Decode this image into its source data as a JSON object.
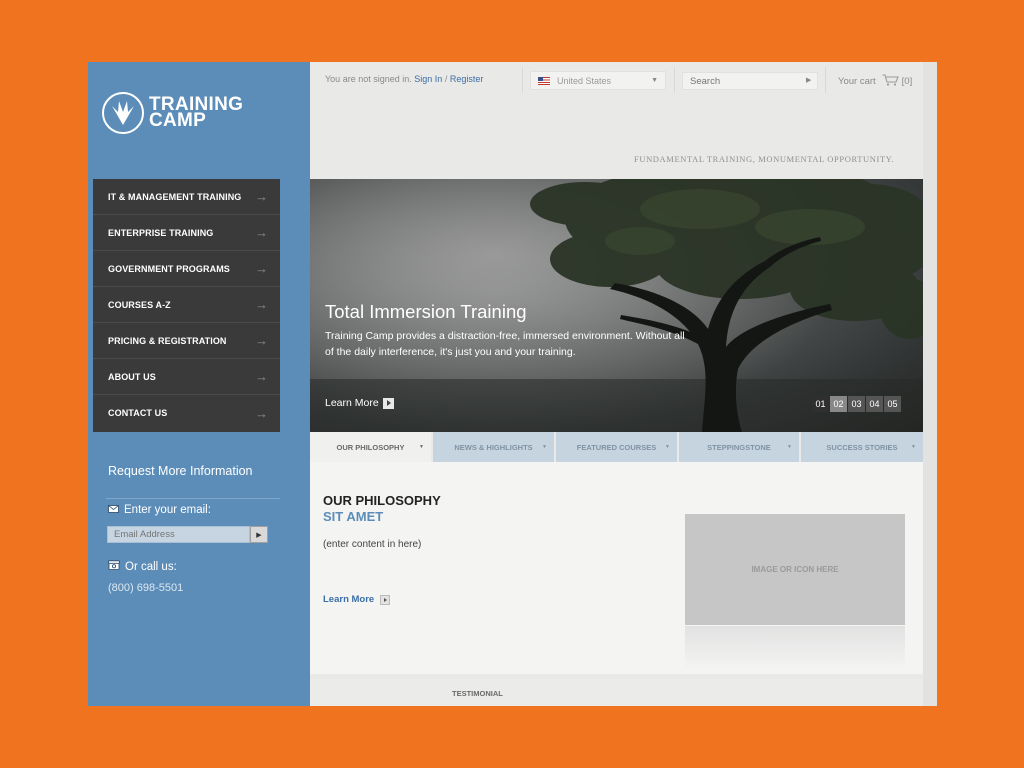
{
  "brand": {
    "line1": "TRAINING",
    "line2": "CAMP"
  },
  "topbar": {
    "signin_prefix": "You are not signed in.",
    "signin_link": "Sign In",
    "separator": "/",
    "register_link": "Register",
    "country": "United States",
    "search_placeholder": "Search",
    "cart_label": "Your cart",
    "cart_count": "[0]"
  },
  "tagline": "FUNDAMENTAL TRAINING, MONUMENTAL OPPORTUNITY.",
  "nav": {
    "items": [
      "IT & MANAGEMENT TRAINING",
      "ENTERPRISE TRAINING",
      "GOVERNMENT PROGRAMS",
      "COURSES A-Z",
      "PRICING & REGISTRATION",
      "ABOUT US",
      "CONTACT US"
    ]
  },
  "hero": {
    "title": "Total Immersion Training",
    "text": "Training Camp provides a distraction-free, immersed environment. Without all of the daily interference, it's just you and your training.",
    "learn_more": "Learn More",
    "pager": [
      "01",
      "02",
      "03",
      "04",
      "05"
    ]
  },
  "sidebar": {
    "request_title": "Request More Information",
    "email_label": "Enter your email:",
    "email_placeholder": "Email Address",
    "call_label": "Or call us:",
    "phone": "(800) 698-5501"
  },
  "tabs": [
    "OUR PHILOSOPHY",
    "NEWS & HIGHLIGHTS",
    "FEATURED COURSES",
    "STEPPINGSTONE",
    "SUCCESS STORIES"
  ],
  "content": {
    "title": "OUR PHILOSOPHY",
    "subtitle": "SIT AMET",
    "body": "(enter content in here)",
    "learn_more": "Learn More",
    "image_placeholder": "IMAGE OR ICON HERE"
  },
  "testimonial": "TESTIMONIAL",
  "colors": {
    "page_bg": "#f07420",
    "sidebar": "#5b8db8",
    "nav_bg": "#3a3a3a",
    "link": "#3b6ea5"
  }
}
